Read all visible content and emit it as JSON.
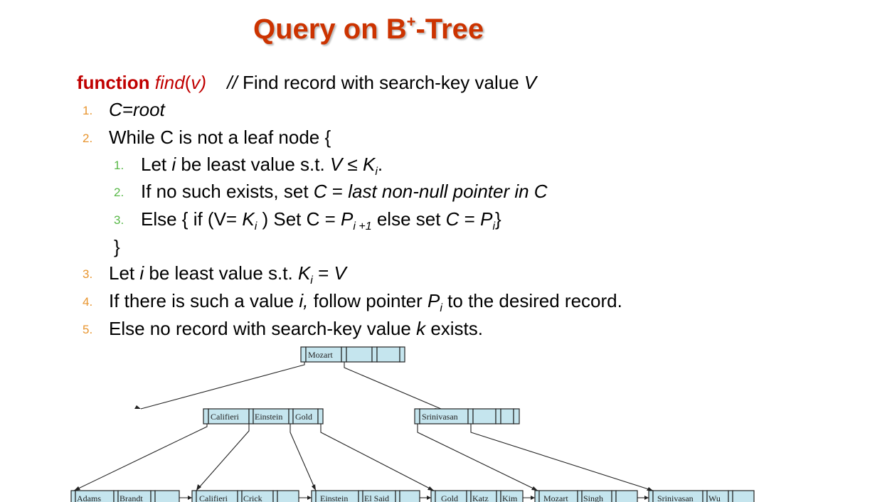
{
  "slide": {
    "title_main": "Query on B",
    "title_sup": "+",
    "title_tail": "-Tree"
  },
  "signature": {
    "keyword": "function",
    "name": "find",
    "param_open": "(",
    "param": "v)",
    "comment_slashes": "//",
    "comment_text": "Find record with search-key value ",
    "comment_var": "V"
  },
  "steps": {
    "s1": {
      "num": "1.",
      "text": "C=root"
    },
    "s2": {
      "num": "2.",
      "text": "While C is not a leaf node {"
    },
    "s2_1": {
      "num": "1.",
      "a": "Let ",
      "b": "i",
      "c": " be least value s.t. ",
      "d": "V",
      "e": " ≤ ",
      "f": "K",
      "g": "i",
      "h": "."
    },
    "s2_2": {
      "num": "2.",
      "a": "If no such exists, set ",
      "b": "C",
      "c": " = ",
      "d": "last non-null pointer in C"
    },
    "s2_3": {
      "num": "3.",
      "a": "Else { if (V= ",
      "b": "K",
      "c": "i",
      "d": " ) Set C = ",
      "e": "P",
      "f": "i +1",
      "g": " else set ",
      "h": "C",
      "i": " = ",
      "j": "P",
      "k": "i",
      "l": "}"
    },
    "close": "}",
    "s3": {
      "num": "3.",
      "a": "Let ",
      "b": "i",
      "c": " be least value s.t. ",
      "d": "K",
      "e": "i",
      "f": " = ",
      "g": "V"
    },
    "s4": {
      "num": "4.",
      "a": "If there is such a value ",
      "b": "i,",
      "c": "  follow pointer ",
      "d": "P",
      "e": "i",
      "f": "  to the desired record."
    },
    "s5": {
      "num": "5.",
      "a": "Else no record with search-key value ",
      "b": "k",
      "c": " exists."
    }
  },
  "tree": {
    "root": [
      "Mozart"
    ],
    "internal_left": [
      "Califieri",
      "Einstein",
      "Gold"
    ],
    "internal_right": [
      "Srinivasan"
    ],
    "leaves": [
      [
        "Adams",
        "Brandt"
      ],
      [
        "Califieri",
        "Crick"
      ],
      [
        "Einstein",
        "El Said"
      ],
      [
        "Gold",
        "Katz",
        "Kim"
      ],
      [
        "Mozart",
        "Singh"
      ],
      [
        "Srinivasan",
        "Wu"
      ]
    ]
  },
  "colors": {
    "title": "#cc3300",
    "keyword": "#c00000",
    "level1_numbers": "#e8952f",
    "level2_numbers": "#58b847",
    "node_fill": "#c5e5ee"
  }
}
